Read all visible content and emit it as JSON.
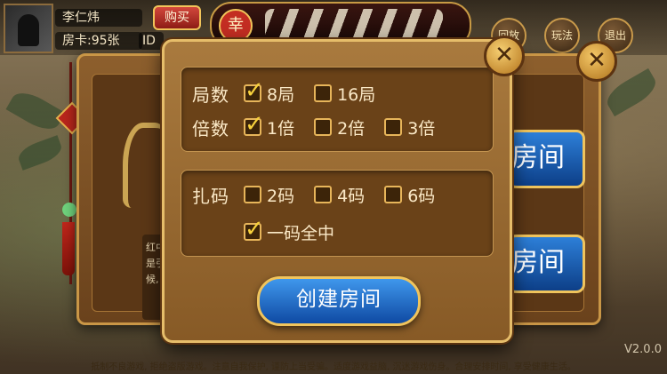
{
  "player": {
    "name": "李仁炜",
    "cards": "房卡:95张",
    "id_label": "ID"
  },
  "top_bar": {
    "buy_label": "购买",
    "logo_seal": "幸",
    "record_label": "回放",
    "rules_label": "玩法",
    "exit_label": "退出"
  },
  "back_panel": {
    "room_buttons": [
      "房间",
      "房间"
    ],
    "description_lines": [
      "红中",
      "是引",
      "候,"
    ]
  },
  "dialog": {
    "close_icon": "✕",
    "rounds": {
      "label": "局数",
      "options": [
        {
          "label": "8局",
          "checked": true
        },
        {
          "label": "16局",
          "checked": false
        }
      ]
    },
    "multiplier": {
      "label": "倍数",
      "options": [
        {
          "label": "1倍",
          "checked": true
        },
        {
          "label": "2倍",
          "checked": false
        },
        {
          "label": "3倍",
          "checked": false
        }
      ]
    },
    "zhama": {
      "label": "扎码",
      "options": [
        {
          "label": "2码",
          "checked": false
        },
        {
          "label": "4码",
          "checked": false
        },
        {
          "label": "6码",
          "checked": false
        }
      ]
    },
    "yima": {
      "label": "一码全中",
      "checked": true
    },
    "create_label": "创建房间"
  },
  "footer": {
    "notice": "抵制不良游戏, 拒绝盗版游戏。注意自我保护, 谨防上当受骗。适度游戏益脑, 沉迷游戏伤身。合理安排时间, 享受健康生活。",
    "version": "V2.0.0"
  },
  "colors": {
    "accent_gold": "#e6bd6a",
    "button_blue": "#1f6ac9",
    "checkbox_check": "#f7d13c"
  }
}
